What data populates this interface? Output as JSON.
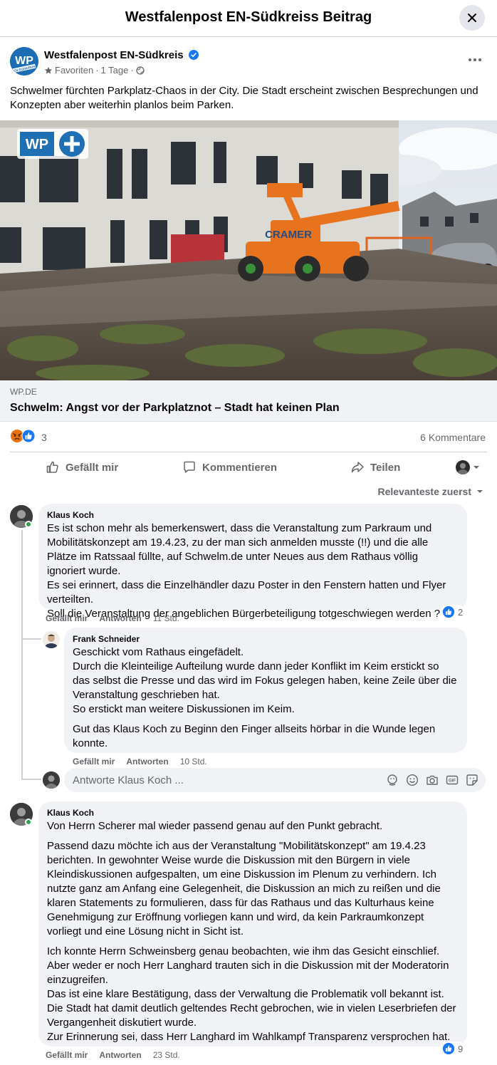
{
  "header": {
    "title": "Westfalenpost EN-Südkreiss Beitrag"
  },
  "post": {
    "page_name": "Westfalenpost EN-Südkreis",
    "logo_text": "WP",
    "logo_subtext": "EN-SÜDKREIS",
    "favorites_label": "Favoriten",
    "time": "1 Tage",
    "separator": "·",
    "text": "Schwelmer fürchten Parkplatz-Chaos in der City. Die Stadt erscheint zwischen Besprechungen und Konzepten aber weiterhin planlos beim Parken.",
    "image": {
      "overlay_logo": "WP",
      "machine_brand": "CRAMER"
    },
    "link": {
      "domain": "WP.DE",
      "title": "Schwelm: Angst vor der Parkplatznot – Stadt hat keinen Plan"
    },
    "reactions_count": "3",
    "comments_count": "6 Kommentare"
  },
  "actions": {
    "like": "Gefällt mir",
    "comment": "Kommentieren",
    "share": "Teilen"
  },
  "sort_label": "Relevanteste zuerst",
  "comments": [
    {
      "author": "Klaus Koch",
      "paragraphs": [
        "Es ist schon mehr als bemerkenswert, dass die Veranstaltung zum Parkraum und Mobilitätskonzept am 19.4.23, zu der man sich anmelden musste (!!) und die alle Plätze im Ratssaal füllte, auf Schwelm.de unter Neues aus dem Rathaus völlig ignoriert wurde.",
        "Es sei erinnert, dass die Einzelhändler dazu Poster in den Fenstern hatten und Flyer verteilten.",
        "Soll die Veranstaltung der angeblichen Bürgerbeteiligung totgeschwiegen werden ?"
      ],
      "like_label": "Gefällt mir",
      "reply_label": "Antworten",
      "time": "11 Std.",
      "likes": "2"
    },
    {
      "author": "Frank Schneider",
      "paragraphs": [
        "Geschickt vom Rathaus eingefädelt.",
        "Durch die Kleinteilige Aufteilung wurde dann jeder Konflikt im Keim erstickt so das selbst die Presse und das wird im Fokus gelegen haben, keine Zeile über die Veranstaltung geschrieben hat.",
        "So erstickt man weitere Diskussionen im Keim.",
        "Gut das Klaus Koch zu Beginn den Finger allseits hörbar in die Wunde legen konnte."
      ],
      "like_label": "Gefällt mir",
      "reply_label": "Antworten",
      "time": "10 Std."
    },
    {
      "author": "Klaus Koch",
      "paragraphs": [
        "Von Herrn Scherer mal wieder passend genau auf den Punkt gebracht.",
        "Passend dazu möchte ich aus der Veranstaltung \"Mobilitätskonzept\" am 19.4.23 berichten. In gewohnter Weise wurde die Diskussion mit den Bürgern in viele Kleindiskussionen aufgespalten, um eine Diskussion im Plenum zu verhindern. Ich nutzte ganz am Anfang eine Gelegenheit, die Diskussion an mich zu reißen und die klaren Statements zu formulieren, dass für das Rathaus und das Kulturhaus keine Genehmigung zur Eröffnung vorliegen kann und wird, da kein Parkraumkonzept vorliegt und eine Lösung nicht in Sicht ist.",
        "Ich konnte Herrn Schweinsberg genau beobachten, wie ihm das Gesicht einschlief. Aber weder er noch Herr Langhard trauten sich in die Diskussion mit der Moderatorin einzugreifen.",
        "Das ist eine klare Bestätigung, dass der Verwaltung die Problematik voll bekannt ist.",
        "Die Stadt hat damit deutlich geltendes Recht gebrochen, wie in vielen Leserbriefen der Vergangenheit diskutiert wurde.",
        "Zur Erinnerung sei, dass Herr Langhard im Wahlkampf Transparenz versprochen hat."
      ],
      "like_label": "Gefällt mir",
      "reply_label": "Antworten",
      "time": "23 Std.",
      "likes": "9"
    }
  ],
  "reply_box": {
    "placeholder": "Antworte Klaus Koch ..."
  },
  "colors": {
    "accent": "#1877f2",
    "text": "#050505",
    "muted": "#65676b",
    "bubble": "#f0f2f5",
    "online": "#31a24c"
  }
}
